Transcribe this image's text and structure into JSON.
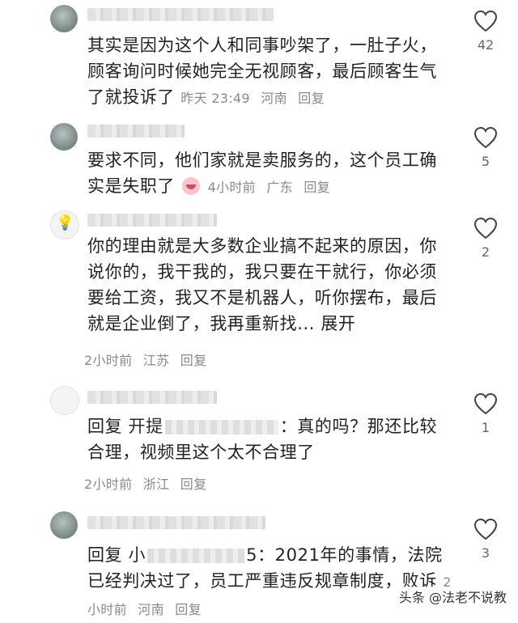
{
  "comments": [
    {
      "text": "其实是因为这个人和同事吵架了，一肚子火，顾客询问时候她完全无视顾客，最后顾客生气了就投诉了",
      "time": "昨天 23:49",
      "location": "河南",
      "reply_label": "回复",
      "likes": "42"
    },
    {
      "text": "要求不同，他们家就是卖服务的，这个员工确实是失职了",
      "time": "4小时前",
      "location": "广东",
      "reply_label": "回复",
      "likes": "5"
    },
    {
      "text": "你的理由就是大多数企业搞不起来的原因，你说你的，我干我的，我只要在干就行，你必须要给工资，我又不是机器人，听你摆布，最后就是企业倒了，我再重新找...",
      "expand_label": "展开",
      "time": "2小时前",
      "location": "江苏",
      "reply_label": "回复",
      "likes": "2"
    },
    {
      "reply_prefix": "回复",
      "reply_to_visible": "开提",
      "text": "：真的吗？那还比较合理，视频里这个太不合理了",
      "time": "2小时前",
      "location": "浙江",
      "reply_label": "回复",
      "likes": "1"
    },
    {
      "reply_prefix": "回复",
      "reply_to_visible": "小",
      "reply_to_tail": "5",
      "text": "：2021年的事情，法院已经判决过了，员工严重违反规章制度，败诉",
      "time": "2小时前",
      "location": "河南",
      "reply_label": "回复",
      "likes": "3"
    }
  ],
  "watermark": "头条 @法老不说教",
  "icons": {
    "like": "heart-outline-icon"
  },
  "colors": {
    "meta": "#8a8a8a",
    "text": "#222222"
  }
}
